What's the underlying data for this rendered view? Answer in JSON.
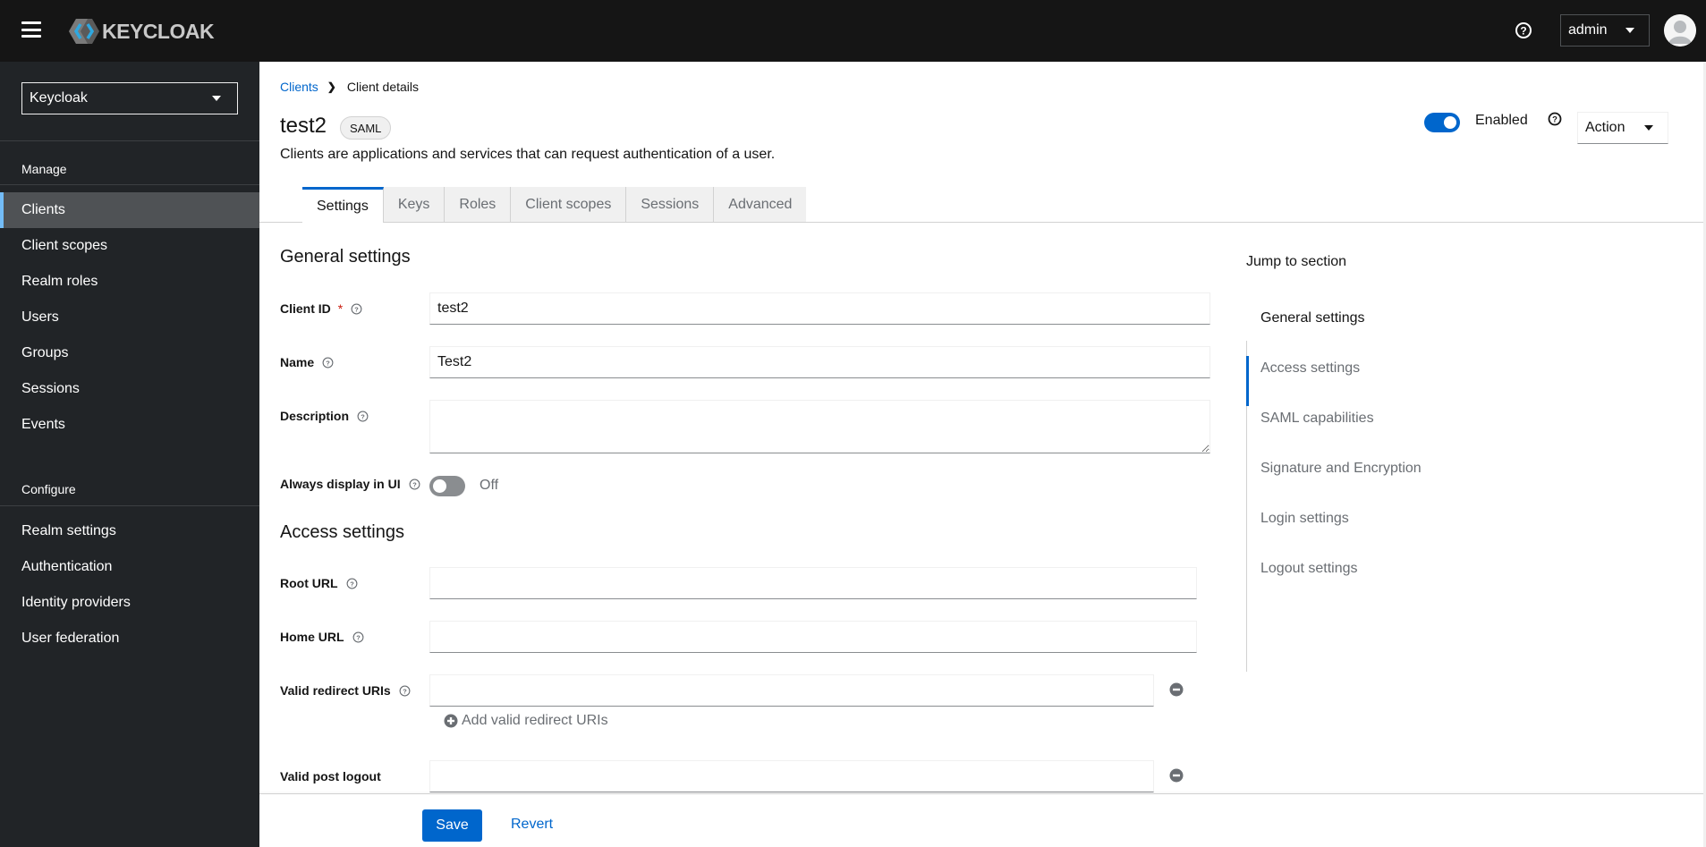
{
  "header": {
    "brand": "KEYCLOAK",
    "user_menu_label": "admin",
    "icons": {
      "menu": "hamburger-icon",
      "help": "help-icon",
      "avatar": "user-avatar-icon"
    }
  },
  "sidebar": {
    "realm": "Keycloak",
    "groups": [
      {
        "label": "Manage",
        "items": [
          {
            "label": "Clients",
            "active": true
          },
          {
            "label": "Client scopes"
          },
          {
            "label": "Realm roles"
          },
          {
            "label": "Users"
          },
          {
            "label": "Groups"
          },
          {
            "label": "Sessions"
          },
          {
            "label": "Events"
          }
        ]
      },
      {
        "label": "Configure",
        "items": [
          {
            "label": "Realm settings"
          },
          {
            "label": "Authentication"
          },
          {
            "label": "Identity providers"
          },
          {
            "label": "User federation"
          }
        ]
      }
    ]
  },
  "breadcrumb": {
    "parent": "Clients",
    "current": "Client details"
  },
  "page": {
    "title": "test2",
    "badge": "SAML",
    "description": "Clients are applications and services that can request authentication of a user.",
    "enabled_label": "Enabled",
    "enabled": true,
    "action_label": "Action"
  },
  "tabs": [
    {
      "label": "Settings",
      "active": true
    },
    {
      "label": "Keys"
    },
    {
      "label": "Roles"
    },
    {
      "label": "Client scopes"
    },
    {
      "label": "Sessions"
    },
    {
      "label": "Advanced"
    }
  ],
  "form": {
    "general": {
      "title": "General settings",
      "client_id_label": "Client ID",
      "required_mark": "*",
      "client_id_value": "test2",
      "name_label": "Name",
      "name_value": "Test2",
      "description_label": "Description",
      "description_value": "",
      "always_display_label": "Always display in UI",
      "always_display_state": "Off"
    },
    "access": {
      "title": "Access settings",
      "root_url_label": "Root URL",
      "root_url_value": "",
      "home_url_label": "Home URL",
      "home_url_value": "",
      "redirect_label": "Valid redirect URIs",
      "redirect_value": "",
      "add_redirect_label": "Add valid redirect URIs",
      "post_logout_label": "Valid post logout",
      "post_logout_value": ""
    }
  },
  "jump": {
    "title": "Jump to section",
    "items": [
      {
        "label": "General settings",
        "active": true
      },
      {
        "label": "Access settings"
      },
      {
        "label": "SAML capabilities"
      },
      {
        "label": "Signature and Encryption"
      },
      {
        "label": "Login settings"
      },
      {
        "label": "Logout settings"
      }
    ]
  },
  "footer": {
    "save_label": "Save",
    "revert_label": "Revert"
  },
  "colors": {
    "primary": "#0066cc",
    "header_bg": "#151515",
    "sidebar_bg": "#212427",
    "active_nav_bg": "#4f5255",
    "active_nav_accent": "#73bcf7",
    "required": "#c9190b"
  }
}
